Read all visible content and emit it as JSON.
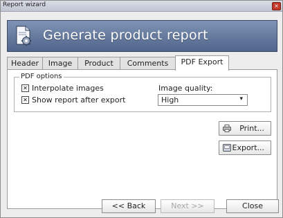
{
  "window": {
    "title": "Report wizard",
    "close_glyph": "×"
  },
  "banner": {
    "title": "Generate product report",
    "icon": "document-gear-icon"
  },
  "tabs": [
    {
      "label": "Header"
    },
    {
      "label": "Image"
    },
    {
      "label": "Product"
    },
    {
      "label": "Comments"
    },
    {
      "label": "PDF Export",
      "active": true
    }
  ],
  "pdf_options": {
    "legend": "PDF options",
    "interpolate": {
      "label": "Interpolate images",
      "checked": true,
      "mark": "✕"
    },
    "show_report": {
      "label": "Show report after export",
      "checked": true,
      "mark": "✕"
    },
    "image_quality": {
      "label": "Image quality:",
      "value": "High",
      "arrow": "▾"
    }
  },
  "actions": {
    "print": {
      "label": "Print...",
      "icon": "printer-icon"
    },
    "export": {
      "label": "Export...",
      "icon": "export-icon"
    }
  },
  "footer": {
    "back": "<< Back",
    "next": "Next >>",
    "close": "Close"
  }
}
